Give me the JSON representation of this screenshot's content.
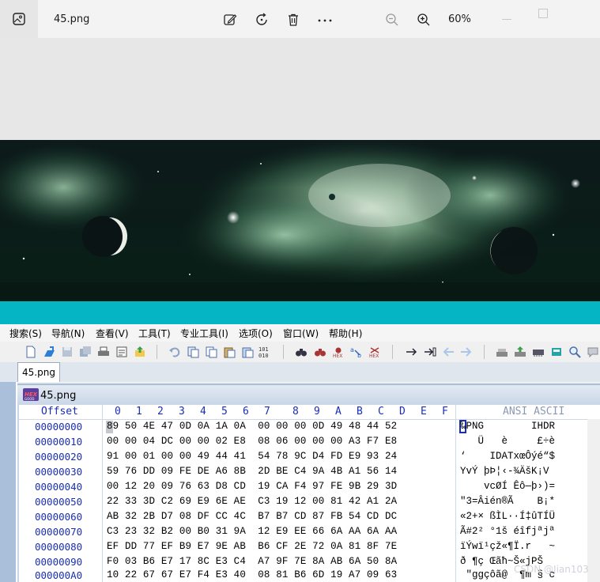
{
  "viewer": {
    "file_name": "45.png",
    "zoom": "60%",
    "icons": [
      "image-app-icon",
      "edit-image-icon",
      "rotate-icon",
      "delete-icon",
      "more-icon",
      "zoom-out-icon",
      "zoom-in-icon",
      "minimize-icon",
      "maximize-icon"
    ]
  },
  "menu": [
    "搜索(S)",
    "导航(N)",
    "查看(V)",
    "工具(T)",
    "专业工具(I)",
    "选项(O)",
    "窗口(W)",
    "帮助(H)"
  ],
  "tab_label": "45.png",
  "doc_title": "45.png",
  "hex_header": {
    "offset_label": "Offset",
    "columns": [
      "0",
      "1",
      "2",
      "3",
      "4",
      "5",
      "6",
      "7",
      "8",
      "9",
      "A",
      "B",
      "C",
      "D",
      "E",
      "F"
    ],
    "ansi_label": "ANSI ASCII"
  },
  "rows": [
    {
      "offset": "00000000",
      "hex": "89 50 4E 47 0D 0A 1A 0A  00 00 00 0D 49 48 44 52",
      "ansi": "‰PNG        IHDR"
    },
    {
      "offset": "00000010",
      "hex": "00 00 04 DC 00 00 02 E8  08 06 00 00 00 A3 F7 E8",
      "ansi": "   Ü   è     £÷è"
    },
    {
      "offset": "00000020",
      "hex": "91 00 01 00 00 49 44 41  54 78 9C D4 FD E9 93 24",
      "ansi": "‘    IDATxœÔýé“$"
    },
    {
      "offset": "00000030",
      "hex": "59 76 DD 09 FE DE A6 8B  2D BE C4 9A 4B A1 56 14",
      "ansi": "YvÝ þÞ¦‹-¾ÄšK¡V"
    },
    {
      "offset": "00000040",
      "hex": "00 12 20 09 76 63 D8 CD  19 CA F4 97 FE 9B 29 3D",
      "ansi": "    vcØÍ Êô—þ›)="
    },
    {
      "offset": "00000050",
      "hex": "22 33 3D C2 69 E9 6E AE  C3 19 12 00 81 42 A1 2A",
      "ansi": "\"3=Âién®Ã    B¡*"
    },
    {
      "offset": "00000060",
      "hex": "AB 32 2B D7 08 DF CC 4C  B7 B7 CD 87 FB 54 CD DC",
      "ansi": "«2+× ßÌL··Í‡ûTÍÜ"
    },
    {
      "offset": "00000070",
      "hex": "C3 23 32 B2 00 B0 31 9A  12 E9 EE 66 6A AA 6A AA",
      "ansi": "Ã#2² °1š éîfjªjª"
    },
    {
      "offset": "00000080",
      "hex": "EF DD 77 EF B9 E7 9E AB  B6 CF 2E 72 0A 81 8F 7E",
      "ansi": "ïÝwï¹çž«¶Ï.r   ~"
    },
    {
      "offset": "00000090",
      "hex": "F0 03 B6 E7 17 8C E3 C4  A7 9F 7E 8A AB 6A 50 8A",
      "ansi": "ð ¶ç Œãħ~Š«jPŠ"
    },
    {
      "offset": "000000A0",
      "hex": "10 22 67 67 E7 F4 E3 40  08 81 B6 6D 19 A7 09 63",
      "ansi": " \"ggçôã@  ¶m § c"
    }
  ],
  "watermark": "CSDN @Jian103"
}
